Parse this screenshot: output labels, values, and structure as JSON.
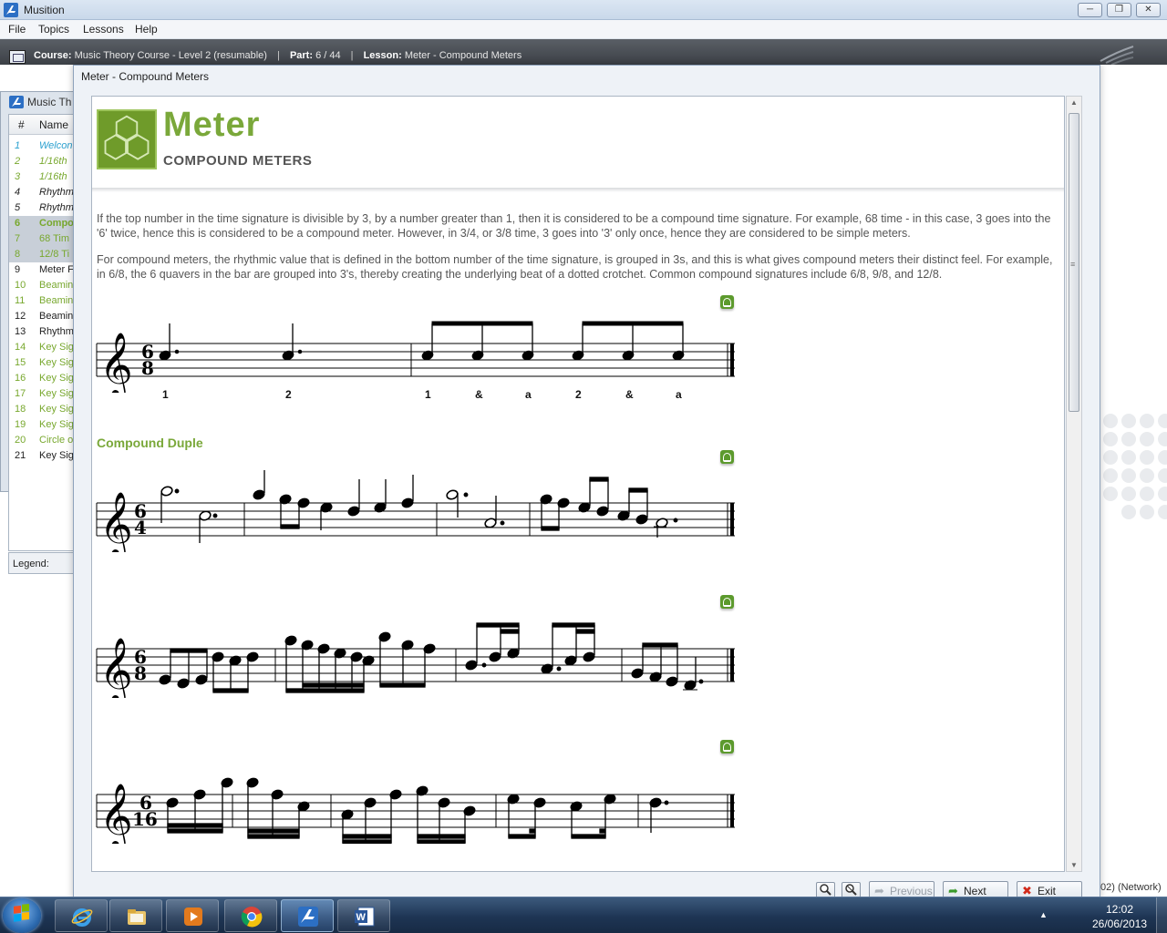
{
  "app": {
    "title": "Musition",
    "menu": [
      "File",
      "Topics",
      "Lessons",
      "Help"
    ]
  },
  "course_bar": {
    "course_label": "Course:",
    "course_value": "Music Theory Course - Level 2 (resumable)",
    "part_label": "Part:",
    "part_value": "6 / 44",
    "lesson_label": "Lesson:",
    "lesson_value": "Meter - Compound Meters"
  },
  "bg_panel": {
    "title": "Music Th",
    "col_num": "#",
    "col_name": "Name",
    "rows": [
      {
        "n": "1",
        "t": "Welcon",
        "color": "#2aa0cf",
        "italic": true
      },
      {
        "n": "2",
        "t": "1/16th",
        "color": "#78a82e",
        "italic": true
      },
      {
        "n": "3",
        "t": "1/16th",
        "color": "#78a82e",
        "italic": true
      },
      {
        "n": "4",
        "t": "Rhythm",
        "color": "#222222",
        "italic": true
      },
      {
        "n": "5",
        "t": "Rhythm",
        "color": "#222222",
        "italic": true
      },
      {
        "n": "6",
        "t": "Compo",
        "color": "#78a82e",
        "italic": false,
        "bold": true
      },
      {
        "n": "7",
        "t": "68 Tim",
        "color": "#78a82e",
        "italic": false
      },
      {
        "n": "8",
        "t": "12/8 Ti",
        "color": "#78a82e",
        "italic": false
      },
      {
        "n": "9",
        "t": "Meter F",
        "color": "#222222",
        "italic": false
      },
      {
        "n": "10",
        "t": "Beamin",
        "color": "#78a82e",
        "italic": false
      },
      {
        "n": "11",
        "t": "Beamin",
        "color": "#78a82e",
        "italic": false
      },
      {
        "n": "12",
        "t": "Beamin",
        "color": "#222222",
        "italic": false
      },
      {
        "n": "13",
        "t": "Rhythm",
        "color": "#222222",
        "italic": false
      },
      {
        "n": "14",
        "t": "Key Sig",
        "color": "#78a82e",
        "italic": false
      },
      {
        "n": "15",
        "t": "Key Sig",
        "color": "#78a82e",
        "italic": false
      },
      {
        "n": "16",
        "t": "Key Sig",
        "color": "#78a82e",
        "italic": false
      },
      {
        "n": "17",
        "t": "Key Sig",
        "color": "#78a82e",
        "italic": false
      },
      {
        "n": "18",
        "t": "Key Sig",
        "color": "#78a82e",
        "italic": false
      },
      {
        "n": "19",
        "t": "Key Sig",
        "color": "#78a82e",
        "italic": false
      },
      {
        "n": "20",
        "t": "Circle o",
        "color": "#78a82e",
        "italic": false
      },
      {
        "n": "21",
        "t": "Key Sig",
        "color": "#222222",
        "italic": false
      }
    ],
    "legend": "Legend:"
  },
  "dialog": {
    "title": "Meter - Compound Meters",
    "lesson_title": "Meter",
    "lesson_subtitle": "COMPOUND METERS",
    "paragraph1": "If the top number in the time signature is divisible by 3, by a number greater than 1, then it is considered to be a compound time signature. For example, 68 time - in this case, 3 goes into the '6' twice, hence this is considered to be a compound meter. However, in 3/4, or 3/8 time, 3 goes into '3' only once, hence they are considered to be simple meters.",
    "paragraph2": "For compound meters, the rhythmic value that is defined in the bottom number of the time signature, is grouped in 3s, and this is what gives compound meters their distinct feel. For example, in 6/8, the 6 quavers in the bar are grouped into 3's, thereby creating the underlying beat of a dotted crotchet. Common compound signatures include 6/8, 9/8, and 12/8.",
    "section_heading": "Compound Duple",
    "counts": [
      "1",
      "2",
      "1",
      "&",
      "a",
      "2",
      "&",
      "a"
    ],
    "staves": [
      {
        "time_top": "6",
        "time_bottom": "8"
      },
      {
        "time_top": "6",
        "time_bottom": "4"
      },
      {
        "time_top": "6",
        "time_bottom": "8"
      },
      {
        "time_top": "6",
        "time_bottom": "16"
      }
    ],
    "buttons": {
      "previous": "Previous",
      "next": "Next",
      "exit": "Exit"
    }
  },
  "network_text": "02) (Network)",
  "taskbar": {
    "time": "12:02",
    "date": "26/06/2013"
  },
  "colors": {
    "accent_green": "#7aa83a",
    "course_bar": "#4a4f56",
    "taskbar": "#1e3554"
  }
}
